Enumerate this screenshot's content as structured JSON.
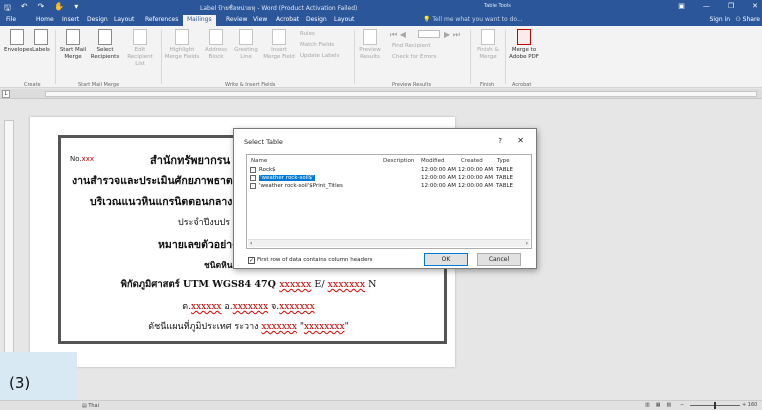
{
  "titlebar": {
    "title": "Label ป้ายชื่อหน่วยหุ - Word (Product Activation Failed)",
    "context": "Table Tools"
  },
  "tabs": [
    "File",
    "Home",
    "Insert",
    "Design",
    "Layout",
    "References",
    "Mailings",
    "Review",
    "View",
    "Acrobat",
    "Design",
    "Layout"
  ],
  "tell_me": "Tell me what you want to do...",
  "sign_in": "Sign in",
  "share": "Share",
  "ribbon": {
    "envelopes": "Envelopes",
    "labels": "Labels",
    "start_mail": "Start Mail Merge",
    "select": "Select Recipients",
    "edit": "Edit Recipient List",
    "highlight": "Highlight Merge Fields",
    "address": "Address Block",
    "greeting": "Greeting Line",
    "insert_merge": "Insert Merge Field",
    "rules": "Rules",
    "match": "Match Fields",
    "update": "Update Labels",
    "preview": "Preview Results",
    "find": "Find Recipient",
    "check": "Check for Errors",
    "finish": "Finish & Merge",
    "merge_pdf": "Merge to Adobe PDF",
    "groups": [
      "Create",
      "Start Mail Merge",
      "Write & Insert Fields",
      "Preview Results",
      "Finish",
      "Acrobat"
    ]
  },
  "document": {
    "no_prefix": "No.",
    "no_value": "xxx",
    "line1": "สำนักทรัพยากรน",
    "line2": "งานสำรวจและประเมินศักยภาพธาต",
    "line3": "บริเวณแนวหินแกรนิตตอนกลาง-ต",
    "line4": "ประจำปีงบปร",
    "line5": "หมายเลขตัวอย่าง",
    "line6": "ชนิดหิน",
    "coord_label": "พิกัดภูมิศาสตร์ UTM WGS84 47Q ",
    "coord_x": "xxxxxx",
    "coord_sep": " E/ ",
    "coord_y": "xxxxxxx",
    "coord_n": " N",
    "loc_t": "ต.",
    "loc_t_val": "xxxxxx",
    "loc_a": " อ.",
    "loc_a_val": "xxxxxxx",
    "loc_j": " จ.",
    "loc_j_val": "xxxxxxx",
    "map_label": "ดัชนีแผนที่ภูมิประเทศ ระวาง ",
    "map_val": "xxxxxxx",
    "map_quote_open": "\"",
    "map_quote_val": "xxxxxxxx",
    "map_quote_close": "\""
  },
  "dialog": {
    "title": "Select Table",
    "help": "?",
    "close": "✕",
    "columns": [
      "Name",
      "Description",
      "Modified",
      "Created",
      "Type"
    ],
    "rows": [
      {
        "name": "Rock$",
        "modified": "12:00:00 AM",
        "created": "12:00:00 AM",
        "type": "TABLE"
      },
      {
        "name": "'weather rock-soil$'",
        "modified": "12:00:00 AM",
        "created": "12:00:00 AM",
        "type": "TABLE"
      },
      {
        "name": "'weather rock-soil'$Print_Titles",
        "modified": "12:00:00 AM",
        "created": "12:00:00 AM",
        "type": "TABLE"
      }
    ],
    "first_row": "First row of data contains column headers",
    "ok": "OK",
    "cancel": "Cancel"
  },
  "step_label": "(3)",
  "status": {
    "language": "Thai",
    "zoom": "160"
  }
}
